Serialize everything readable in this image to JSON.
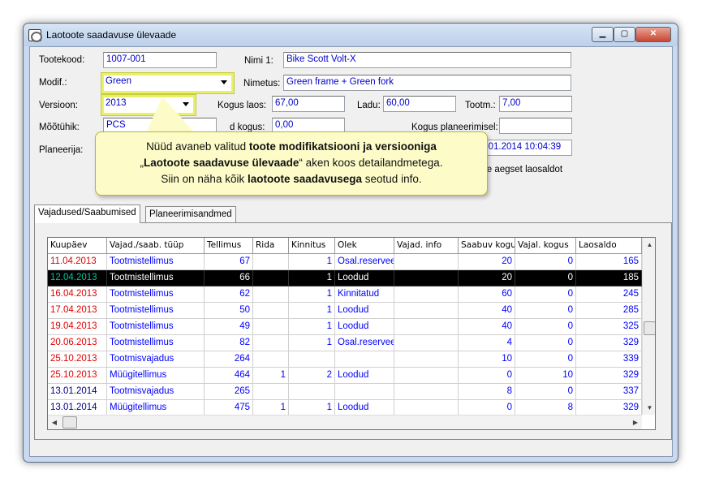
{
  "window": {
    "title": "Laotoote saadavuse ülevaade"
  },
  "form": {
    "tootekood_label": "Tootekood:",
    "tootekood_value": "1007-001",
    "nimi1_label": "Nimi 1:",
    "nimi1_value": "Bike Scott Volt-X",
    "modif_label": "Modif.:",
    "modif_value": "Green",
    "nimetus_label": "Nimetus:",
    "nimetus_value": "Green frame + Green fork",
    "versioon_label": "Versioon:",
    "versioon_value": "2013",
    "kogus_laos_label": "Kogus laos:",
    "kogus_laos_value": "67,00",
    "ladu_label": "Ladu:",
    "ladu_value": "60,00",
    "tootm_label": "Tootm.:",
    "tootm_value": "7,00",
    "mootuhik_label": "Mõõtühik:",
    "mootuhik_value": "PCS",
    "kogus2_label": "d kogus:",
    "kogus2_value": "0,00",
    "kogus_plan_label": "Kogus planeerimisel:",
    "kogus_plan_value": "",
    "planeerija_label": "Planeerija:",
    "date_value": "3.01.2014 10:04:39",
    "laosaldo_text": "se aegset laosaldot"
  },
  "callout": {
    "l1a": "Nüüd avaneb valitud ",
    "l1b": "toote modifikatsiooni  ja versiooniga",
    "l2a": "„",
    "l2b": "Laotoote saadavuse ülevaade",
    "l2c": "“ aken koos detailandmetega.",
    "l3a": "Siin on näha kõik ",
    "l3b": "laotoote saadavusega",
    "l3c": " seotud info."
  },
  "tabs": [
    "Vajadused/Saabumised",
    "Planeerimisandmed"
  ],
  "table": {
    "columns": [
      "Kuupäev",
      "Vajad./saab. tüüp",
      "Tellimus",
      "Rida",
      "Kinnitus",
      "Olek",
      "Vajad. info",
      "Saabuv kogus",
      "Vajal. kogus",
      "Laosaldo"
    ],
    "rows": [
      [
        "11.04.2013",
        "Tootmistellimus",
        "67",
        "",
        "1",
        "Osal.reserveeritud",
        "",
        "20",
        "0",
        "165"
      ],
      [
        "12.04.2013",
        "Tootmistellimus",
        "66",
        "",
        "1",
        "Loodud",
        "",
        "20",
        "0",
        "185"
      ],
      [
        "16.04.2013",
        "Tootmistellimus",
        "62",
        "",
        "1",
        "Kinnitatud",
        "",
        "60",
        "0",
        "245"
      ],
      [
        "17.04.2013",
        "Tootmistellimus",
        "50",
        "",
        "1",
        "Loodud",
        "",
        "40",
        "0",
        "285"
      ],
      [
        "19.04.2013",
        "Tootmistellimus",
        "49",
        "",
        "1",
        "Loodud",
        "",
        "40",
        "0",
        "325"
      ],
      [
        "20.06.2013",
        "Tootmistellimus",
        "82",
        "",
        "1",
        "Osal.reserveeritud",
        "",
        "4",
        "0",
        "329"
      ],
      [
        "25.10.2013",
        "Tootmisvajadus",
        "264",
        "",
        "",
        "",
        "",
        "10",
        "0",
        "339"
      ],
      [
        "25.10.2013",
        "Müügitellimus",
        "464",
        "1",
        "2",
        "Loodud",
        "",
        "0",
        "10",
        "329"
      ],
      [
        "13.01.2014",
        "Tootmisvajadus",
        "265",
        "",
        "",
        "",
        "",
        "8",
        "0",
        "337"
      ],
      [
        "13.01.2014",
        "Müügitellimus",
        "475",
        "1",
        "1",
        "Loodud",
        "",
        "0",
        "8",
        "329"
      ]
    ]
  },
  "colors": {
    "date_red": "#e00000",
    "date_navy": "#000080",
    "date_selected": "#00c8a0",
    "text_blue": "#0000ff",
    "callout_bg": "#fdfcc9",
    "highlight": "#e8f06a"
  }
}
